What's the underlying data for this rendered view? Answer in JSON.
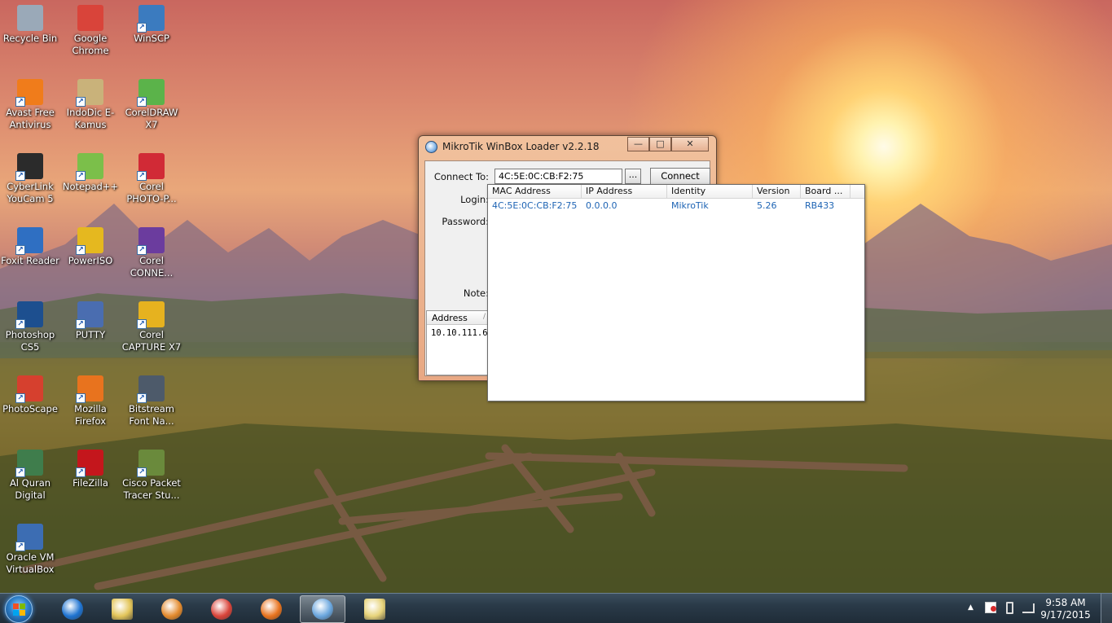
{
  "desktop": {
    "icons": [
      {
        "label": "Recycle Bin",
        "icon": "recycle-bin-icon",
        "color": "#9aa9b8"
      },
      {
        "label": "Google Chrome",
        "icon": "chrome-icon",
        "color": "#d9443a"
      },
      {
        "label": "WinSCP",
        "icon": "winscp-icon",
        "color": "#3b7bbf"
      },
      {
        "label": "Avast Free Antivirus",
        "icon": "avast-icon",
        "color": "#f07c1b"
      },
      {
        "label": "IndoDic E-Kamus",
        "icon": "indodic-icon",
        "color": "#c9b27a"
      },
      {
        "label": "CorelDRAW X7",
        "icon": "coreldraw-icon",
        "color": "#5bb34a"
      },
      {
        "label": "CyberLink YouCam 5",
        "icon": "youcam-icon",
        "color": "#2b2b2b"
      },
      {
        "label": "Notepad++",
        "icon": "notepadpp-icon",
        "color": "#7bbf4a"
      },
      {
        "label": "Corel PHOTO-P...",
        "icon": "corel-photo-paint-icon",
        "color": "#d12a36"
      },
      {
        "label": "Foxit Reader",
        "icon": "foxit-icon",
        "color": "#2f6fc2"
      },
      {
        "label": "PowerISO",
        "icon": "poweriso-icon",
        "color": "#e5b81f"
      },
      {
        "label": "Corel CONNE...",
        "icon": "corel-connect-icon",
        "color": "#6b3c9e"
      },
      {
        "label": "Photoshop CS5",
        "icon": "photoshop-icon",
        "color": "#1d4f8f"
      },
      {
        "label": "PUTTY",
        "icon": "putty-icon",
        "color": "#4a6db0"
      },
      {
        "label": "Corel CAPTURE X7",
        "icon": "corel-capture-icon",
        "color": "#e6b21f"
      },
      {
        "label": "PhotoScape",
        "icon": "photoscape-icon",
        "color": "#d6402e"
      },
      {
        "label": "Mozilla Firefox",
        "icon": "firefox-icon",
        "color": "#e8731e"
      },
      {
        "label": "Bitstream Font Na...",
        "icon": "bitstream-icon",
        "color": "#4d5a6a"
      },
      {
        "label": "Al Quran Digital",
        "icon": "alquran-icon",
        "color": "#3f7d4c"
      },
      {
        "label": "FileZilla",
        "icon": "filezilla-icon",
        "color": "#c4161c"
      },
      {
        "label": "Cisco Packet Tracer Stu...",
        "icon": "cisco-packet-tracer-icon",
        "color": "#6a8a3c"
      },
      {
        "label": "Oracle VM VirtualBox",
        "icon": "virtualbox-icon",
        "color": "#3c6db3"
      }
    ]
  },
  "winbox": {
    "title": "MikroTik WinBox Loader v2.2.18",
    "connect_to_label": "Connect To:",
    "connect_to_value": "4C:5E:0C:CB:F2:75",
    "browse_button": "...",
    "connect_button": "Connect",
    "login_label": "Login:",
    "password_label": "Password:",
    "note_label": "Note:",
    "address_header": "Address",
    "address_sort": "/",
    "saved_address": "10.10.111.6",
    "minimize": "—",
    "maximize": "□",
    "close": "✕"
  },
  "neighbors": {
    "columns": [
      "MAC Address",
      "IP Address",
      "Identity",
      "Version",
      "Board ..."
    ],
    "rows": [
      [
        "4C:5E:0C:CB:F2:75",
        "0.0.0.0",
        "MikroTik",
        "5.26",
        "RB433"
      ]
    ]
  },
  "taskbar": {
    "apps": [
      "internet-explorer-icon",
      "file-explorer-icon",
      "media-player-icon",
      "chrome-icon",
      "firefox-icon",
      "winbox-icon",
      "folder-icon"
    ],
    "time": "9:58 AM",
    "date": "9/17/2015"
  }
}
